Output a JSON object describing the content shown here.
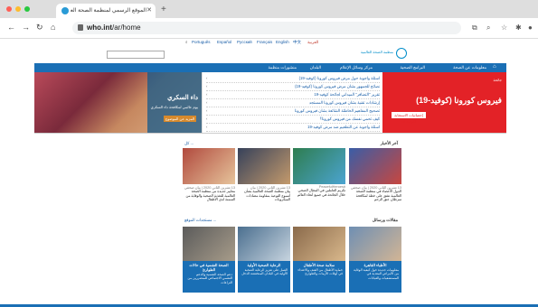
{
  "browser": {
    "tab_title": "الموقع الرسمي لمنظمة الصحة العالمية",
    "url_bold": "who.int",
    "url_rest": "/ar/home",
    "dot_colors": [
      "#ff5f57",
      "#febc2e",
      "#28c840"
    ]
  },
  "languages": [
    "العربية",
    "中文",
    "English",
    "Français",
    "Русский",
    "Español",
    "Português"
  ],
  "logo_text": "منظمة الصحة العالمية",
  "menu": [
    "معلومات عن الصحة",
    "البرامج الصحية",
    "مركز وسائل الإعلام",
    "البلدان",
    "منشورات منظمة"
  ],
  "hero": {
    "photo_heading": "داء السكري",
    "photo_sub": "يوم عالمي لمكافحة داء السكري",
    "photo_button": "المزيد عن الموضوع",
    "covid_small": "جائحة",
    "covid_title": "فيروس كورونا (كوفيد-19)",
    "covid_button": "إحصائيات الاستجابة لكوفيد-19",
    "news_items": [
      "أسئلة وأجوبة حول مرض فيروس كورونا (كوفيد-19)",
      "نصائح للجمهور بشأن مرض فيروس كورونا (كوفيد-19)",
      "تقرير \"التضافر\" الميداني لجائحة كوفيد-19",
      "إرشادات تقنية بشأن فيروس كورونا المستجد",
      "تصحيح المفاهيم الخاطئة الشائعة بشأن فيروس كورونا",
      "كيف تحمي نفسك من فيروس كورونا؟",
      "أسئلة وأجوبة عن التطعيم ضد مرض كوفيد-19"
    ]
  },
  "latest": {
    "heading": "آخر الأخبار",
    "more": "كل ...",
    "cards": [
      {
        "date": "13 تشرين الثاني 2020 | بيان صحفي",
        "text": "الدول الأعضاء في منظمة الصحة العالمية تتفق على خطة لمكافحة سرطان عنق الرحم",
        "c1": "#3a5da6",
        "c2": "#c8473f"
      },
      {
        "date": "#PeacefulHeroes",
        "text": "تكريم العاملين في المجال الصحي خلال الجائحة في جميع أنحاء العالم",
        "c1": "#2e7d4f",
        "c2": "#4ba4d1"
      },
      {
        "date": "13 تشرين الثاني 2020 | بيان",
        "text": "بيان منظمة الصحة العالمية بشأن أسبوع التوعية بمقاومة مضادات الميكروبات",
        "c1": "#36415a",
        "c2": "#c49a6c"
      },
      {
        "date": "13 تشرين الثاني 2020 | بيان صحفي",
        "text": "معايير جديدة من منظمة الصحة العالمية للتغذية الصحية والوقاية من السمنة لدى الأطفال",
        "c1": "#b14a3e",
        "c2": "#e6c49b"
      }
    ]
  },
  "features": {
    "heading": "مقالات ورسائل",
    "more": "مستجدات الموقع ...",
    "cards": [
      {
        "title": "الأطباء القاهرة",
        "text": "معلومات جديدة حول كيفية الوقاية من الأمراض المعدية في المستشفيات والعيادات",
        "c1": "#6f8fb3",
        "c2": "#d2b595"
      },
      {
        "title": "سلامة صحة الأطفال",
        "text": "حماية الأطفال من العنف والاعتداء في أوقات الأزمات والطوارئ",
        "c1": "#8a6a4b",
        "c2": "#d9b88c"
      },
      {
        "title": "الرعاية الصحية الأولية",
        "text": "العمل على تعزيز الرعاية الصحية الأولية في البلدان المنخفضة الدخل",
        "c1": "#4b6f8f",
        "c2": "#c7d4df"
      },
      {
        "title": "الصحة النفسية في حالات الطوارئ",
        "text": "دعم الصحة النفسية والدعم النفسي الاجتماعي للمتضررين من النزاعات",
        "c1": "#5b5b5b",
        "c2": "#a79c8a"
      }
    ]
  }
}
